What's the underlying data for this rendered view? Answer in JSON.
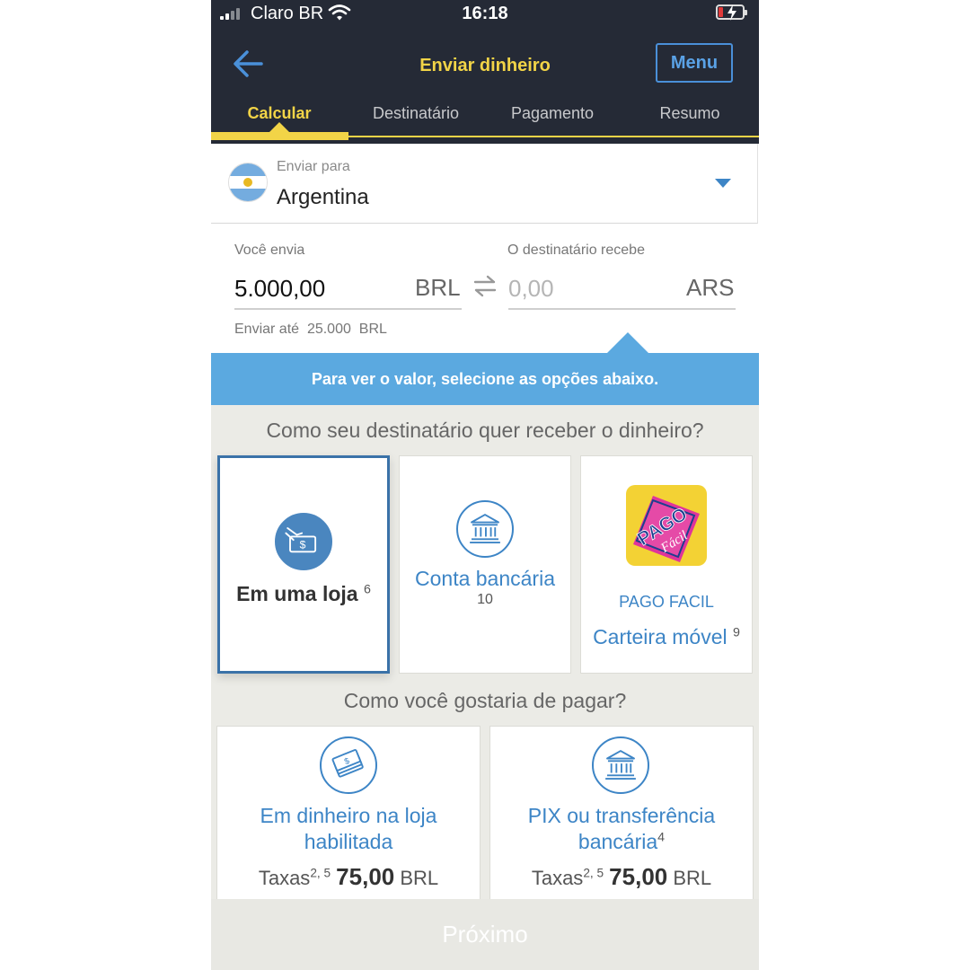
{
  "status_bar": {
    "carrier": "Claro BR",
    "time": "16:18"
  },
  "header": {
    "title": "Enviar dinheiro",
    "menu_label": "Menu"
  },
  "tabs": [
    {
      "label": "Calcular",
      "active": true
    },
    {
      "label": "Destinatário",
      "active": false
    },
    {
      "label": "Pagamento",
      "active": false
    },
    {
      "label": "Resumo",
      "active": false
    }
  ],
  "country": {
    "label": "Enviar para",
    "value": "Argentina"
  },
  "send": {
    "label": "Você envia",
    "amount": "5.000,00",
    "currency": "BRL"
  },
  "receive": {
    "label": "O destinatário recebe",
    "placeholder": "0,00",
    "currency": "ARS"
  },
  "limit": {
    "text": "Enviar até",
    "amount": "25.000",
    "currency": "BRL"
  },
  "hint": "Para ver o valor, selecione as opções abaixo.",
  "receive_section": {
    "question": "Como seu destinatário quer receber o dinheiro?",
    "options": [
      {
        "label": "Em uma loja",
        "sup": "6",
        "selected": true
      },
      {
        "label": "Conta bancária",
        "sub": "10"
      },
      {
        "brand": "PAGO FACIL",
        "label": "Carteira móvel",
        "sup": "9",
        "logo_text": "PAGO",
        "logo_sub": "Fácil"
      }
    ]
  },
  "pay_section": {
    "question": "Como você gostaria de pagar?",
    "options": [
      {
        "line1": "Em dinheiro na loja",
        "line2": "habilitada",
        "line2_sup": "",
        "fee_label": "Taxas",
        "fee_sup": "2, 5",
        "fee_amount": "75,00",
        "fee_currency": "BRL"
      },
      {
        "line1": "PIX ou transferência",
        "line2": "bancária",
        "line2_sup": "4",
        "fee_label": "Taxas",
        "fee_sup": "2, 5",
        "fee_amount": "75,00",
        "fee_currency": "BRL"
      }
    ]
  },
  "next_button": "Próximo",
  "colors": {
    "header_bg": "#252a36",
    "accent_yellow": "#f2d447",
    "brand_blue": "#3d85c6",
    "hint_blue": "#5ba9e0"
  }
}
